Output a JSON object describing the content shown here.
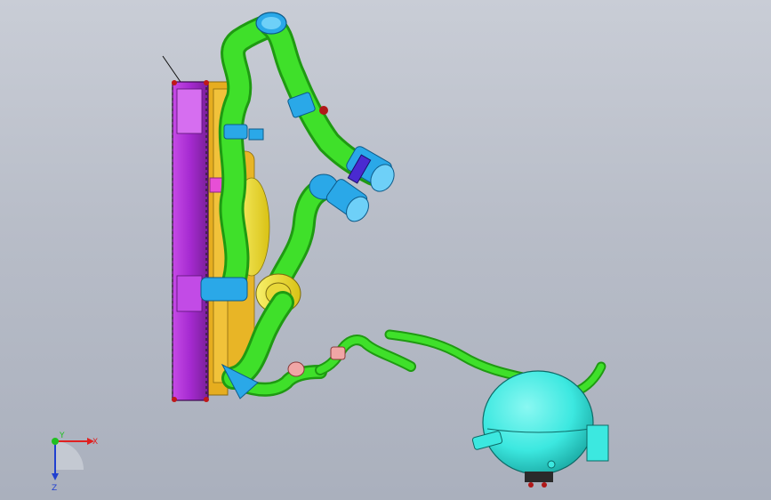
{
  "viewport": {
    "background_top": "#c9cdd6",
    "background_bottom": "#aab0bd"
  },
  "colors": {
    "radiator": "#b52fd9",
    "radiator_dark": "#7a1f99",
    "fan_shroud": "#e8b526",
    "fan_motor": "#f2ea2a",
    "hose": "#3fe02a",
    "hose_dark": "#1f9a12",
    "coupling": "#2aa8e8",
    "coupling_dark": "#146fa8",
    "clamp_purple": "#4a2ad1",
    "clamp_pink": "#f0a6a6",
    "reservoir": "#3ce8e0",
    "reservoir_dark": "#1aa9a3"
  },
  "triad": {
    "x_label": "X",
    "y_label": "Y",
    "z_label": "Z",
    "x_color": "#e02020",
    "y_color": "#20c020",
    "z_color": "#2040d0"
  },
  "model": {
    "components": [
      {
        "name": "radiator",
        "icon": "radiator-core"
      },
      {
        "name": "fan-shroud",
        "icon": "fan-assembly"
      },
      {
        "name": "upper-hose",
        "icon": "hose"
      },
      {
        "name": "lower-hose",
        "icon": "hose"
      },
      {
        "name": "bleed-line",
        "icon": "hose"
      },
      {
        "name": "expansion-tank",
        "icon": "reservoir-sphere"
      }
    ]
  }
}
